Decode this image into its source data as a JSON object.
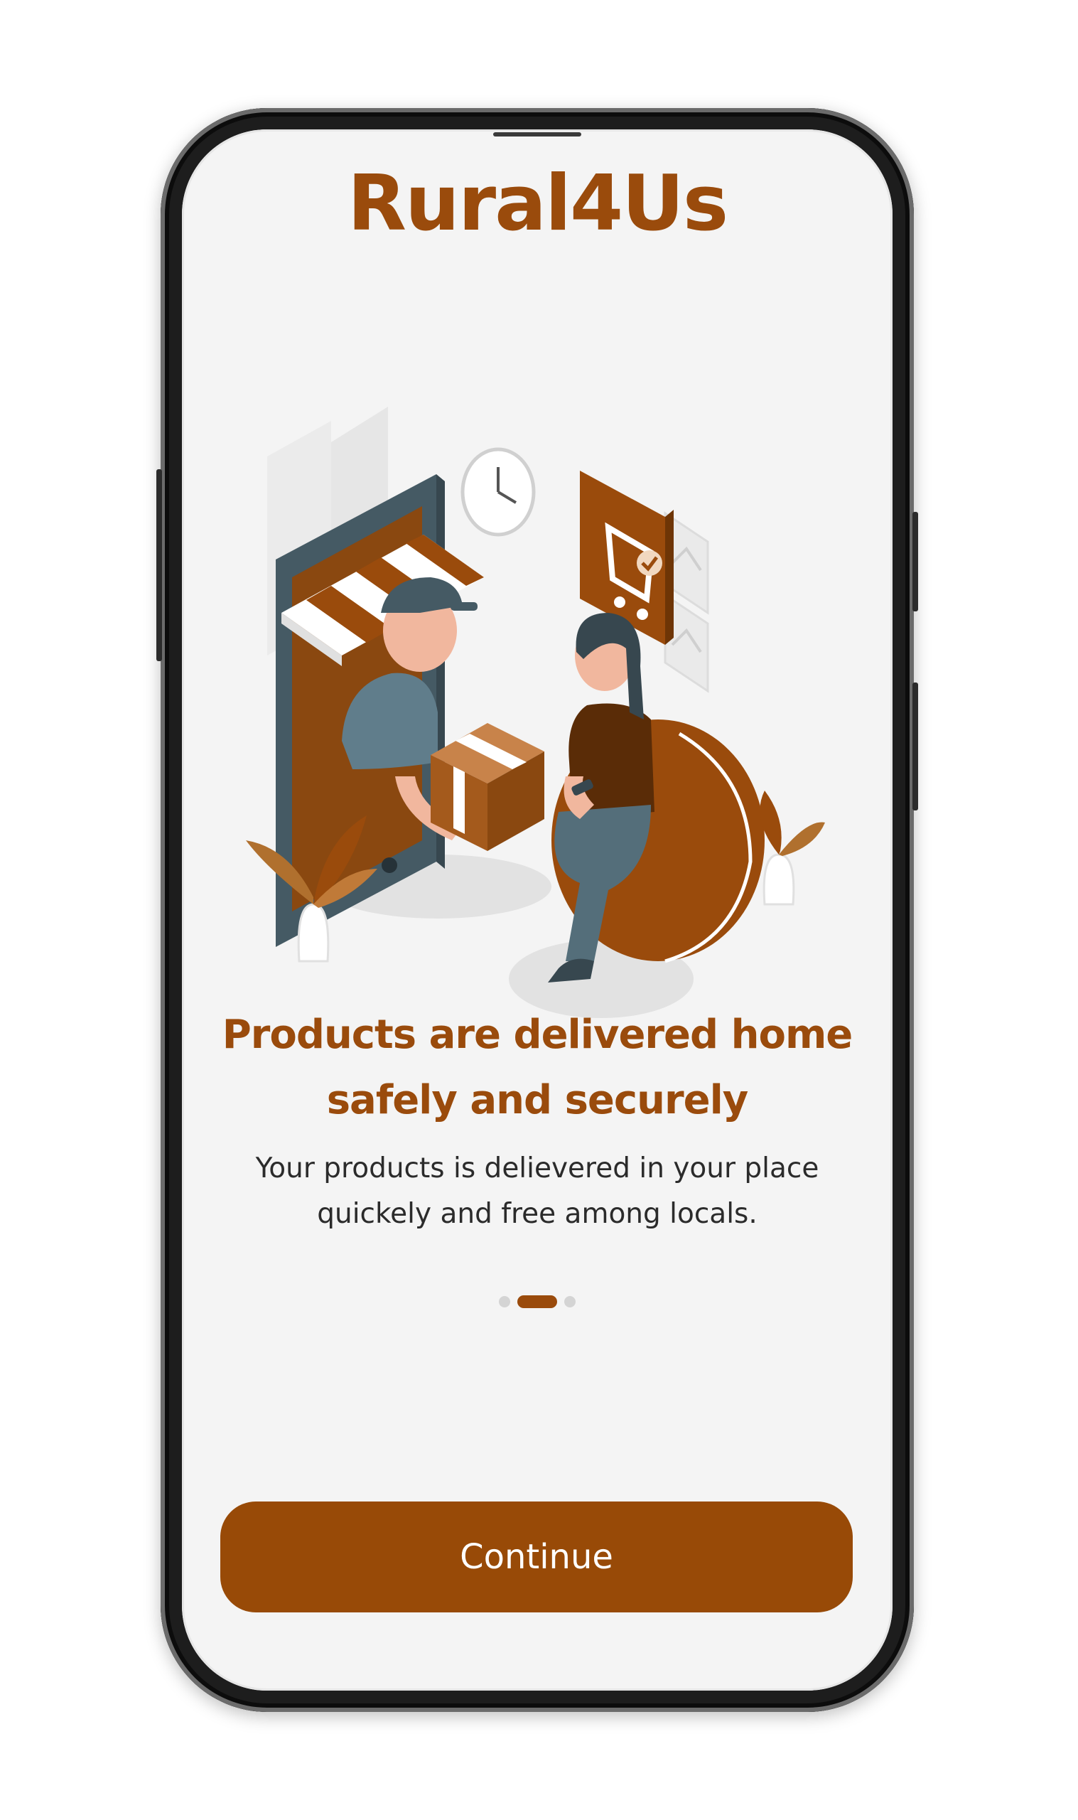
{
  "app": {
    "title": "Rural4Us"
  },
  "onboarding": {
    "heading_line1": "Products are delivered home",
    "heading_line2": "safely and securely",
    "subtitle_line1": "Your products is delievered in your place",
    "subtitle_line2": "quickely and free among locals.",
    "page_indicator": {
      "total": 3,
      "active_index": 1
    },
    "illustration_icon": "delivery-illustration"
  },
  "actions": {
    "continue_label": "Continue"
  },
  "colors": {
    "brand": "#9a4b0c",
    "button": "#984a07",
    "background": "#f4f4f4",
    "text": "#2b2b2b"
  }
}
